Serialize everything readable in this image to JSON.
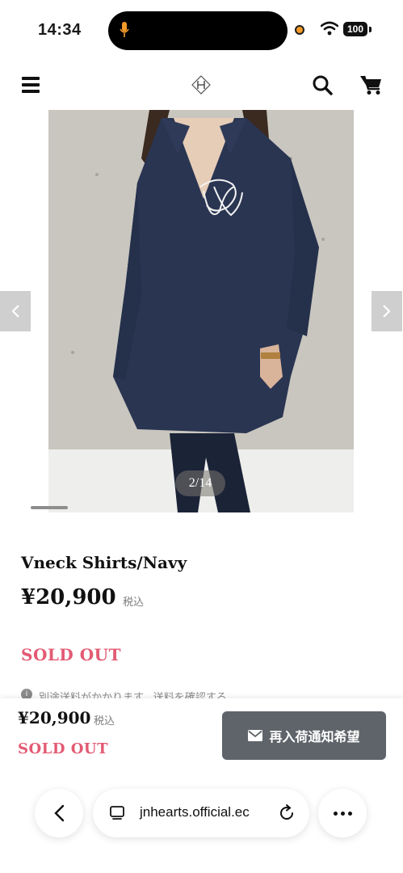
{
  "status_bar": {
    "time": "14:34",
    "battery": "100"
  },
  "header": {
    "logo_icon": "jn-monogram-logo-icon"
  },
  "gallery": {
    "counter": "2/14"
  },
  "product": {
    "name": "Vneck Shirts/Navy",
    "price": "¥20,900",
    "tax_label": "税込",
    "status": "SOLD OUT",
    "shipping_note": "別途送料がかかります。送料を確認する"
  },
  "sticky_bar": {
    "price": "¥20,900",
    "tax_label": "税込",
    "status": "SOLD OUT",
    "notify_label": "再入荷通知希望"
  },
  "browser": {
    "url": "jnhearts.official.ec"
  },
  "colors": {
    "sold_out": "#e35a73",
    "notify_button": "#5f646a"
  }
}
